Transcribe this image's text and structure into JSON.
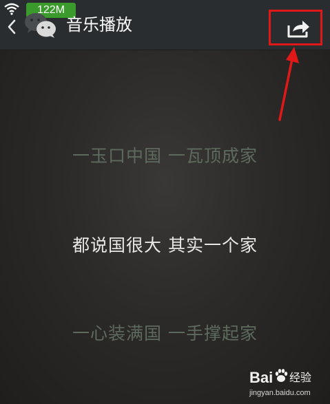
{
  "status_bar": {
    "memory": "122M",
    "wifi_icon": "wifi-icon"
  },
  "header": {
    "back_icon": "chevron-left-icon",
    "logo_icon": "wechat-logo-icon",
    "title": "音乐播放",
    "share_icon": "share-icon"
  },
  "annotation": {
    "highlight_color": "#e01818",
    "arrow_icon": "red-arrow-icon"
  },
  "lyrics": [
    {
      "text": "一玉口中国 一瓦顶成家",
      "state": "inactive"
    },
    {
      "text": "都说国很大 其实一个家",
      "state": "active"
    },
    {
      "text": "一心装满国 一手撑起家",
      "state": "inactive"
    }
  ],
  "watermark": {
    "brand": "Bai",
    "paw_icon": "baidu-paw-icon",
    "name": "经验",
    "url": "jingyan.baidu.com"
  },
  "colors": {
    "header_bg": "#2a2d2f",
    "lyric_active": "#e8e8e8",
    "lyric_inactive": "#5e6a5e",
    "memory_badge": "#3a9a2c"
  }
}
